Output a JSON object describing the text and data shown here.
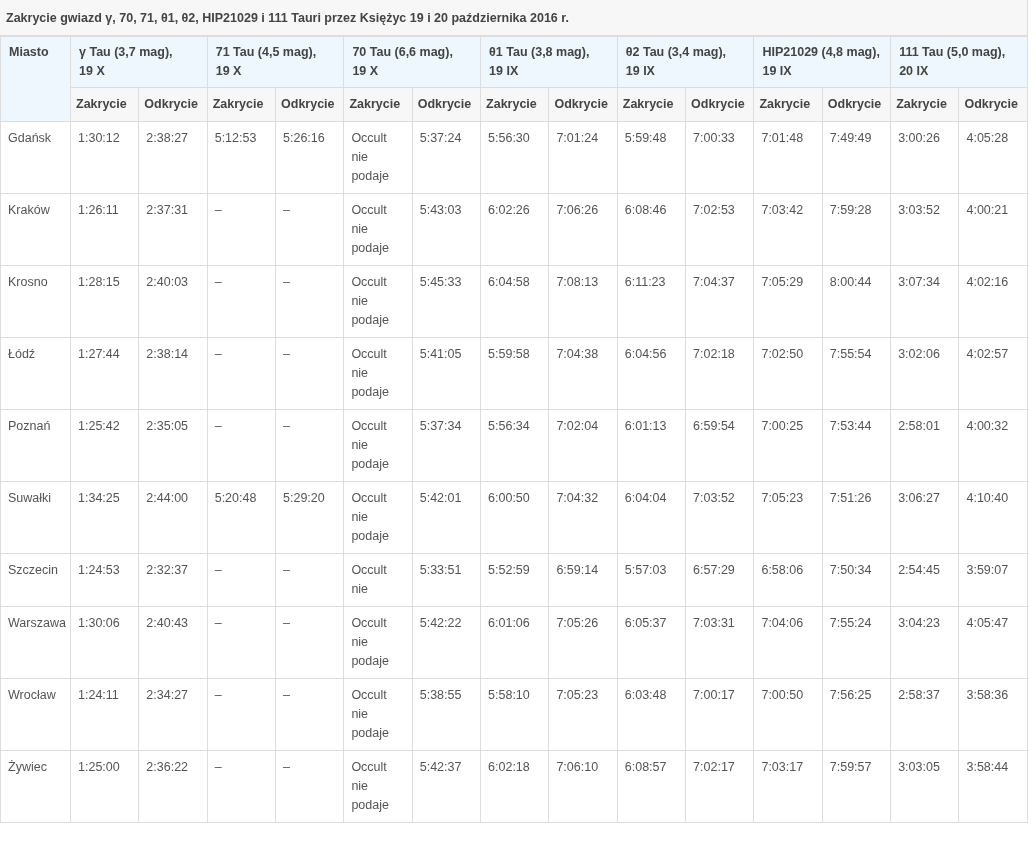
{
  "title": "Zakrycie gwiazd γ, 70, 71, θ1, θ2, HIP21029 i 111 Tauri przez Księżyc 19 i 20 października 2016 r.",
  "table": {
    "city_header": "Miasto",
    "columns": [
      {
        "header": "γ Tau (3,7 mag),\n19 X",
        "subheaders": [
          "Zakrycie",
          "Odkrycie"
        ]
      },
      {
        "header": "71 Tau (4,5 mag),\n19 X",
        "subheaders": [
          "Zakrycie",
          "Odkrycie"
        ]
      },
      {
        "header": "70 Tau (6,6 mag),\n19 X",
        "subheaders": [
          "Zakrycie",
          "Odkrycie"
        ]
      },
      {
        "header": "θ1 Tau (3,8 mag),\n19 IX",
        "subheaders": [
          "Zakrycie",
          "Odkrycie"
        ]
      },
      {
        "header": "θ2 Tau (3,4 mag),\n19 IX",
        "subheaders": [
          "Zakrycie",
          "Odkrycie"
        ]
      },
      {
        "header": "HIP21029 (4,8 mag),\n19 IX",
        "subheaders": [
          "Zakrycie",
          "Odkrycie"
        ]
      },
      {
        "header": "111 Tau (5,0 mag),\n20 IX",
        "subheaders": [
          "Zakrycie",
          "Odkrycie"
        ]
      }
    ],
    "rows": [
      {
        "city": "Gdańsk",
        "times": [
          "1:30:12",
          "2:38:27",
          "5:12:53",
          "5:26:16",
          "Occult nie podaje",
          "5:37:24",
          "5:56:30",
          "7:01:24",
          "5:59:48",
          "7:00:33",
          "7:01:48",
          "7:49:49",
          "3:00:26",
          "4:05:28"
        ]
      },
      {
        "city": "Kraków",
        "times": [
          "1:26:11",
          "2:37:31",
          "–",
          "–",
          "Occult nie podaje",
          "5:43:03",
          "6:02:26",
          "7:06:26",
          "6:08:46",
          "7:02:53",
          "7:03:42",
          "7:59:28",
          "3:03:52",
          "4:00:21"
        ]
      },
      {
        "city": "Krosno",
        "times": [
          "1:28:15",
          "2:40:03",
          "–",
          "–",
          "Occult nie podaje",
          "5:45:33",
          "6:04:58",
          "7:08:13",
          "6:11:23",
          "7:04:37",
          "7:05:29",
          "8:00:44",
          "3:07:34",
          "4:02:16"
        ]
      },
      {
        "city": "Łódź",
        "times": [
          "1:27:44",
          "2:38:14",
          "–",
          "–",
          "Occult nie podaje",
          "5:41:05",
          "5:59:58",
          "7:04:38",
          "6:04:56",
          "7:02:18",
          "7:02:50",
          "7:55:54",
          "3:02:06",
          "4:02:57"
        ]
      },
      {
        "city": "Poznań",
        "times": [
          "1:25:42",
          "2:35:05",
          "–",
          "–",
          "Occult nie podaje",
          "5:37:34",
          "5:56:34",
          "7:02:04",
          "6:01:13",
          "6:59:54",
          "7:00:25",
          "7:53:44",
          "2:58:01",
          "4:00:32"
        ]
      },
      {
        "city": "Suwałki",
        "times": [
          "1:34:25",
          "2:44:00",
          "5:20:48",
          "5:29:20",
          "Occult nie podaje",
          "5:42:01",
          "6:00:50",
          "7:04:32",
          "6:04:04",
          "7:03:52",
          "7:05:23",
          "7:51:26",
          "3:06:27",
          "4:10:40"
        ]
      },
      {
        "city": "Szczecin",
        "times": [
          "1:24:53",
          "2:32:37",
          "–",
          "–",
          "Occult nie",
          "5:33:51",
          "5:52:59",
          "6:59:14",
          "5:57:03",
          "6:57:29",
          "6:58:06",
          "7:50:34",
          "2:54:45",
          "3:59:07"
        ]
      },
      {
        "city": "Warszawa",
        "times": [
          "1:30:06",
          "2:40:43",
          "–",
          "–",
          "Occult nie podaje",
          "5:42:22",
          "6:01:06",
          "7:05:26",
          "6:05:37",
          "7:03:31",
          "7:04:06",
          "7:55:24",
          "3:04:23",
          "4:05:47"
        ]
      },
      {
        "city": "Wrocław",
        "times": [
          "1:24:11",
          "2:34:27",
          "–",
          "–",
          "Occult nie podaje",
          "5:38:55",
          "5:58:10",
          "7:05:23",
          "6:03:48",
          "7:00:17",
          "7:00:50",
          "7:56:25",
          "2:58:37",
          "3:58:36"
        ]
      },
      {
        "city": "Żywiec",
        "times": [
          "1:25:00",
          "2:36:22",
          "–",
          "–",
          "Occult nie podaje",
          "5:42:37",
          "6:02:18",
          "7:06:10",
          "6:08:57",
          "7:02:17",
          "7:03:17",
          "7:59:57",
          "3:03:05",
          "3:58:44"
        ]
      }
    ]
  }
}
